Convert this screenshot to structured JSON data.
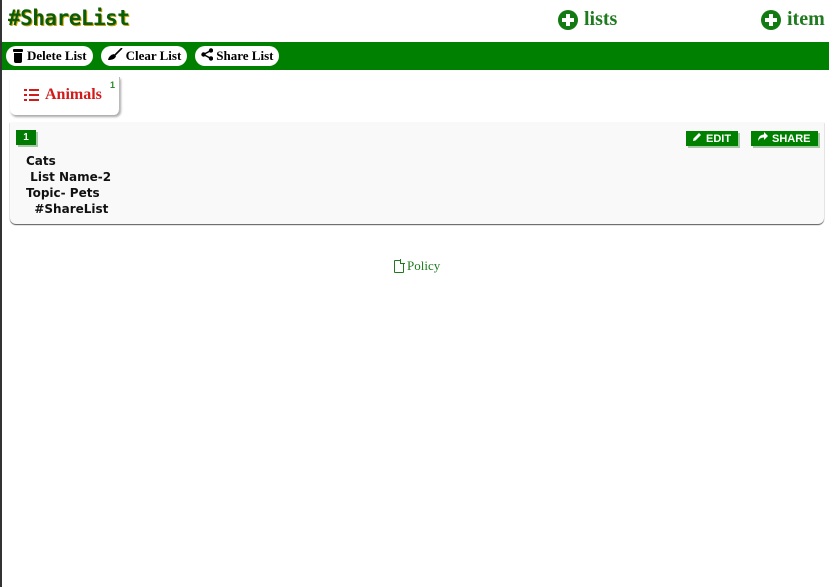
{
  "header": {
    "brand": "#ShareList",
    "lists_link": "lists",
    "item_link": "item",
    "icons": {
      "add": "plus-circle-icon"
    }
  },
  "toolbar": {
    "delete_label": "Delete List",
    "clear_label": "Clear List",
    "share_label": "Share List",
    "icons": {
      "delete": "trash-icon",
      "clear": "broom-icon",
      "share": "share-nodes-icon"
    }
  },
  "tab": {
    "label": "Animals",
    "count": "1",
    "icon": "list-icon"
  },
  "card": {
    "index": "1",
    "lines": [
      "Cats",
      " List Name-2",
      "Topic- Pets",
      "  #ShareList"
    ],
    "edit_label": "EDIT",
    "share_label": "SHARE",
    "icons": {
      "edit": "pencil-icon",
      "share": "share-arrow-icon"
    }
  },
  "footer": {
    "policy_label": "Policy",
    "icon": "file-icon"
  },
  "colors": {
    "brand_green": "#008000",
    "tab_red": "#d11a1a",
    "link_green": "#1f7a1f"
  }
}
